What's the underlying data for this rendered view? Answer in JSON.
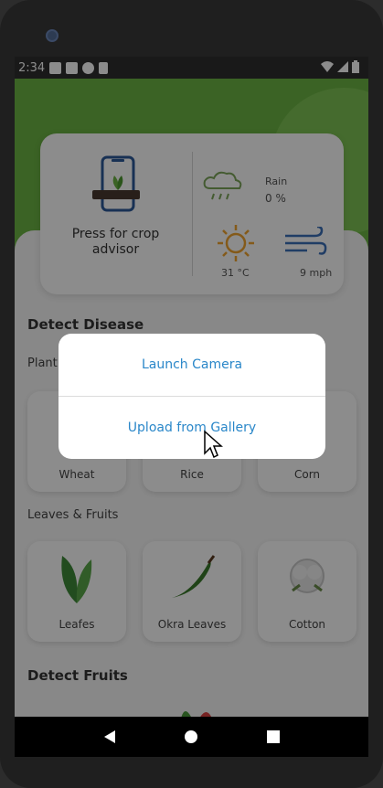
{
  "status_bar": {
    "time": "2:34"
  },
  "advisor": {
    "label": "Press for crop advisor"
  },
  "weather": {
    "rain_label": "Rain",
    "rain_value": "0 %",
    "temperature": "31 °C",
    "wind": "9 mph"
  },
  "detect_disease": {
    "title": "Detect Disease",
    "plants_subtitle": "Plant",
    "plants": [
      {
        "label": "Wheat"
      },
      {
        "label": "Rice"
      },
      {
        "label": "Corn"
      }
    ],
    "leaves_subtitle": "Leaves & Fruits",
    "leaves": [
      {
        "label": "Leafes"
      },
      {
        "label": "Okra Leaves"
      },
      {
        "label": "Cotton"
      }
    ]
  },
  "detect_fruits": {
    "title": "Detect Fruits"
  },
  "dialog": {
    "camera_label": "Launch Camera",
    "gallery_label": "Upload from Gallery"
  },
  "colors": {
    "accent": "#2a87c9",
    "brand_green": "#6cb444"
  },
  "navigation": {
    "back": "back-icon",
    "home": "home-icon",
    "recents": "recents-icon"
  }
}
